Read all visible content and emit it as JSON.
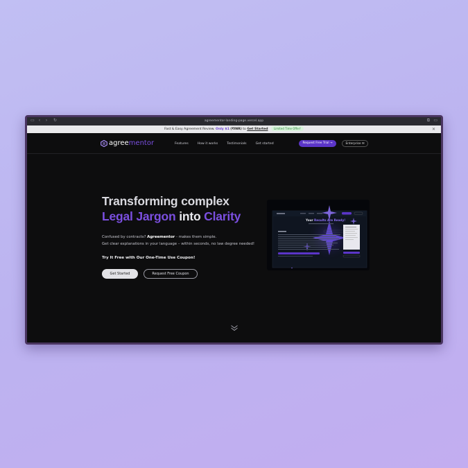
{
  "browser": {
    "url": "agreementor-landing-page.vercel.app"
  },
  "banner": {
    "text_a": "Fast & Easy Agreement Review.",
    "text_only": "Only $1",
    "text_inr": "(₹INR)",
    "text_to": "to",
    "link": "Get Started",
    "badge": "Limited Time Offer!"
  },
  "nav": {
    "logo_a": "agree",
    "logo_b": "mentor",
    "links": [
      "Features",
      "How it works",
      "Testimonials",
      "Get started"
    ],
    "trial_label": "Request Free Trial",
    "enterprise_label": "Enterprise"
  },
  "hero": {
    "line1": "Transforming complex",
    "line2_a": "Legal Jargon",
    "line2_b": "into",
    "line2_c": "Clarity",
    "sub1_a": "Confused by contracts?",
    "sub1_b": "Agreementor",
    "sub1_c": "- makes them simple.",
    "sub2": "Get clear explanations in your language – within seconds, no law degree needed!",
    "cta": "Try It Free with Our One-Time Use Coupon!",
    "btn_primary": "Get Started",
    "btn_secondary": "Request Free Coupon"
  },
  "preview": {
    "title_a": "Your",
    "title_b": "Results Are Ready!"
  },
  "colors": {
    "accent": "#7b4fe0",
    "button_purple": "#5b35c8",
    "background": "#0d0d0e"
  }
}
